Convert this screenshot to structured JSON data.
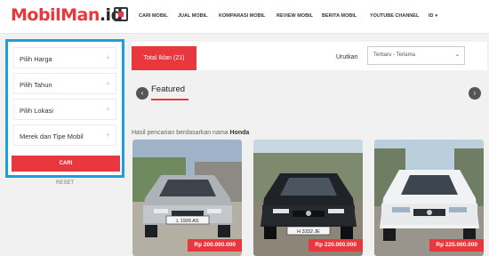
{
  "brand": {
    "part1": "MobilMan",
    "part2": ".id"
  },
  "nav": [
    {
      "label": "CARI MOBIL"
    },
    {
      "label": "JUAL MOBIL"
    },
    {
      "label": "KOMPARASI MOBIL"
    },
    {
      "label": "REVIEW MOBIL"
    },
    {
      "label": "BERITA MOBIL"
    },
    {
      "label": "YOUTUBE CHANNEL"
    },
    {
      "label": "ID"
    }
  ],
  "sidebar": {
    "filters": [
      {
        "label": "Pilih Harga"
      },
      {
        "label": "Pilih Tahun"
      },
      {
        "label": "Pilih Lokasi"
      },
      {
        "label": "Merek dan Tipe Mobil"
      }
    ],
    "search_label": "CARI",
    "reset_label": "RESET"
  },
  "results": {
    "total_label": "Total Iklan (21)",
    "sort_label": "Urutkan",
    "sort_value": "Terbaru - Terlama",
    "featured_title": "Featured",
    "search_prefix": "Hasil pencarian berdasarkan nama",
    "search_term": "Honda"
  },
  "listings": [
    {
      "price": "Rp 200.000.000",
      "plate": "L 1926 AS"
    },
    {
      "price": "Rp 220.000.000",
      "plate": "H 3332 JE"
    },
    {
      "price": "Rp 225.000.000",
      "plate": ""
    }
  ],
  "colors": {
    "accent": "#e8383d",
    "highlight_border": "#1e9fd8"
  }
}
